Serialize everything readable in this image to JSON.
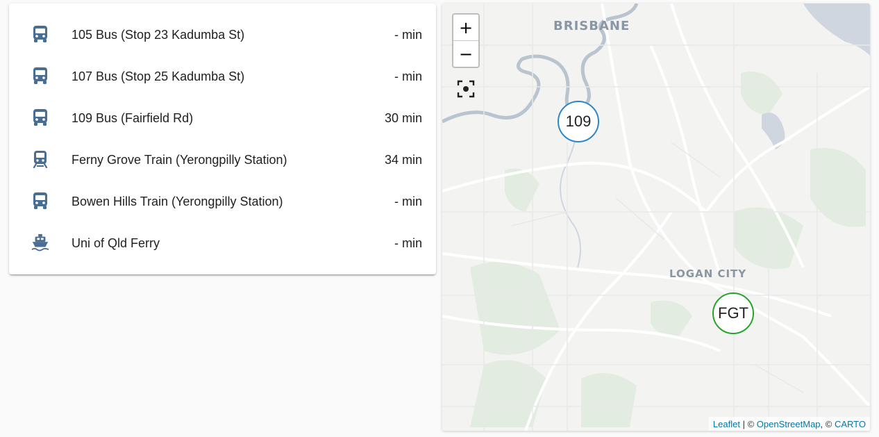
{
  "colors": {
    "icon": "#4a6d94",
    "route_109": "#2d87c8",
    "route_fgt": "#25a52a",
    "link": "#0078a8"
  },
  "departures": [
    {
      "icon": "bus-icon",
      "name": "105 Bus (Stop 23 Kadumba St)",
      "time": "- min"
    },
    {
      "icon": "bus-icon",
      "name": "107 Bus (Stop 25 Kadumba St)",
      "time": "- min"
    },
    {
      "icon": "bus-icon",
      "name": "109 Bus (Fairfield Rd)",
      "time": "30 min"
    },
    {
      "icon": "train-icon",
      "name": "Ferny Grove Train (Yerongpilly Station)",
      "time": "34 min"
    },
    {
      "icon": "train-icon",
      "name": "Bowen Hills Train (Yerongpilly Station)",
      "time": "- min"
    },
    {
      "icon": "ferry-icon",
      "name": "Uni of Qld Ferry",
      "time": "- min"
    }
  ],
  "map": {
    "zoom_in": "+",
    "zoom_out": "−",
    "locate_icon": "locate-icon",
    "place_labels": {
      "brisbane": "BRISBANE",
      "logan": "LOGAN CITY"
    },
    "markers": {
      "m109": "109",
      "fgt": "FGT"
    },
    "attribution": {
      "leaflet": "Leaflet",
      "sep1": " | © ",
      "osm": "OpenStreetMap",
      "sep2": ", © ",
      "carto": "CARTO"
    }
  }
}
